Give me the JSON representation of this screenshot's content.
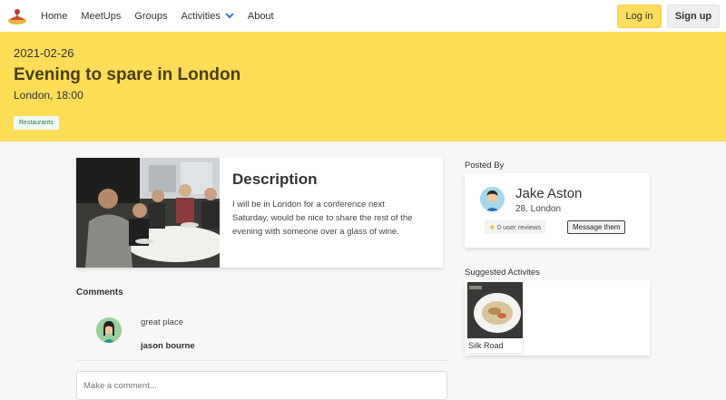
{
  "nav": {
    "logo": "logo-icon",
    "links": [
      "Home",
      "MeetUps",
      "Groups",
      "Activities",
      "About"
    ],
    "login": "Log in",
    "signup": "Sign up"
  },
  "hero": {
    "date": "2021-02-26",
    "title": "Evening to spare in London",
    "subtitle": "London, 18:00",
    "tag": "Restaurants"
  },
  "event": {
    "description_title": "Description",
    "description_text": "I will be in London for a conference next Saturday, would be nice to share the rest of the evening with someone over a glass of wine."
  },
  "comments": {
    "label": "Comments",
    "items": [
      {
        "text": "great place",
        "author": "jason bourne"
      }
    ],
    "placeholder": "Make a comment..."
  },
  "poster": {
    "label": "Posted By",
    "name": "Jake Aston",
    "details": "28, London",
    "reviews": "0 user reviews",
    "message_button": "Message them"
  },
  "suggested": {
    "label": "Suggested Activites",
    "items": [
      {
        "name": "Silk Road"
      }
    ]
  },
  "colors": {
    "hero_bg": "#ffdd57",
    "login_bg": "#fddd5c",
    "tag_text": "#257942"
  }
}
